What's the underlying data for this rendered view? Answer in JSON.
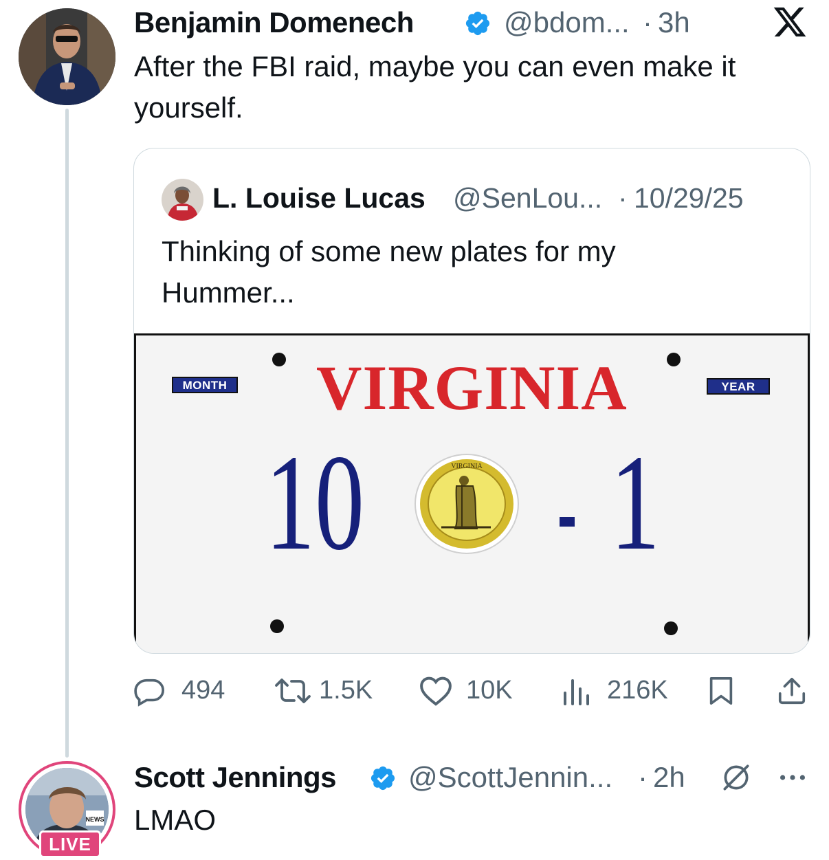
{
  "tweet": {
    "author_name": "Benjamin Domenech",
    "handle": "@bdom...",
    "separator": "·",
    "time": "3h",
    "text": "After the FBI raid, maybe you can even make it yourself."
  },
  "quote": {
    "author_name": "L. Louise Lucas",
    "handle": "@SenLou...",
    "separator": "·",
    "date": "10/29/25",
    "text": "Thinking of some new plates for my Hummer...",
    "plate": {
      "month_label": "MONTH",
      "year_label": "YEAR",
      "state": "VIRGINIA",
      "number_left": "10",
      "number_right": "1",
      "seal_text": "VIRGINIA"
    }
  },
  "actions": {
    "replies": "494",
    "reposts": "1.5K",
    "likes": "10K",
    "views": "216K"
  },
  "reply": {
    "author_name": "Scott Jennings",
    "handle": "@ScottJennin...",
    "separator": "·",
    "time": "2h",
    "text": "LMAO",
    "live_badge": "LIVE",
    "avatar_logo_text": "NEWS"
  },
  "colors": {
    "verified": "#1d9bf0",
    "text_primary": "#0f1419",
    "text_secondary": "#536471",
    "live_pink": "#e0457b",
    "plate_red": "#d8262b",
    "plate_blue": "#16207a"
  },
  "icons": [
    "x-logo-icon",
    "verified-badge-icon",
    "reply-icon",
    "repost-icon",
    "like-icon",
    "views-icon",
    "bookmark-icon",
    "share-icon",
    "grok-icon",
    "more-icon"
  ]
}
